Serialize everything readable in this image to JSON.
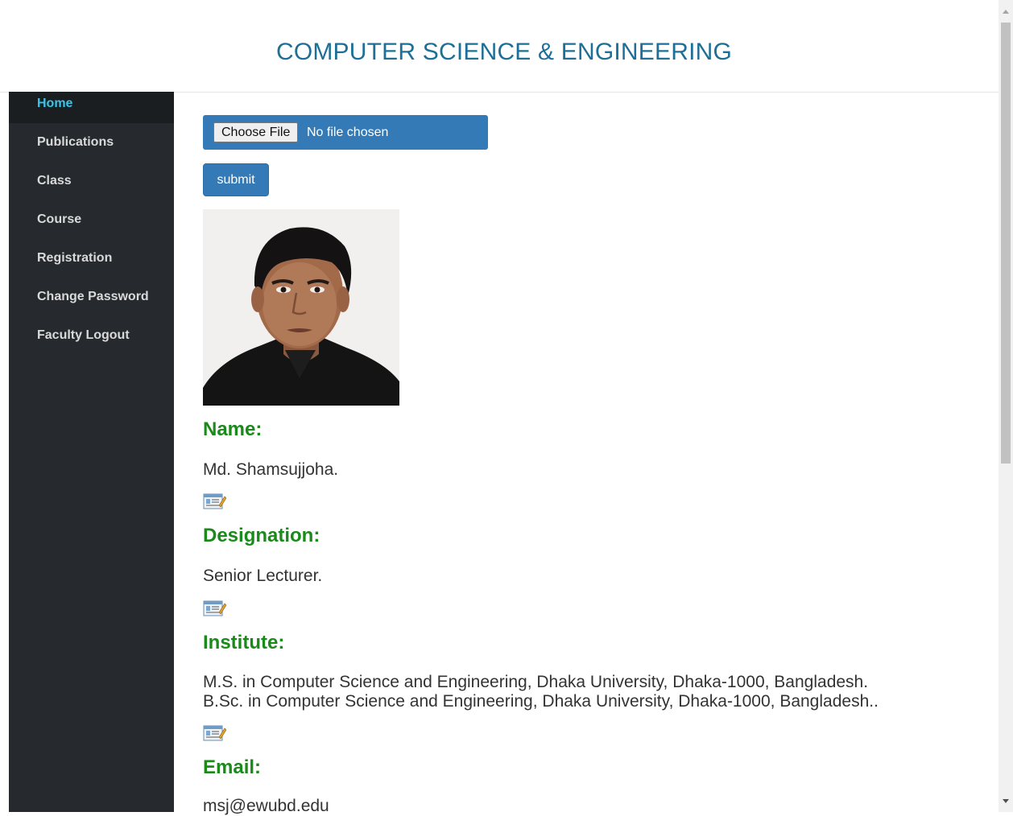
{
  "header": {
    "title": "COMPUTER SCIENCE & ENGINEERING"
  },
  "sidebar": {
    "items": [
      {
        "label": "Home",
        "active": true
      },
      {
        "label": "Publications"
      },
      {
        "label": "Class"
      },
      {
        "label": "Course"
      },
      {
        "label": "Registration"
      },
      {
        "label": "Change Password"
      },
      {
        "label": "Faculty Logout"
      }
    ]
  },
  "upload": {
    "choose_label": "Choose File",
    "status": "No file chosen",
    "submit_label": "submit"
  },
  "profile": {
    "name_label": "Name:",
    "name": "Md. Shamsujjoha.",
    "designation_label": "Designation:",
    "designation": "Senior Lecturer.",
    "institute_label": "Institute:",
    "institute_line1": "M.S. in Computer Science and Engineering, Dhaka University, Dhaka-1000, Bangladesh.",
    "institute_line2": "B.Sc. in Computer Science and Engineering, Dhaka University, Dhaka-1000, Bangladesh..",
    "email_label": "Email:",
    "email": "msj@ewubd.edu"
  },
  "colors": {
    "accent": "#337ab7",
    "title": "#1e6f97",
    "label_green": "#1a8a1a",
    "sidebar_bg": "#262a2e",
    "active_link": "#3cc4e8"
  }
}
